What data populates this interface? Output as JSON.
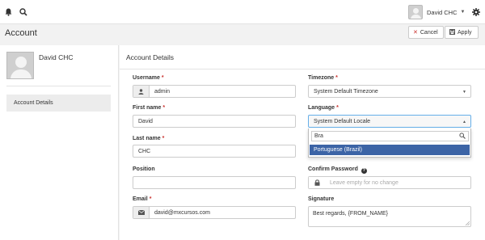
{
  "topbar": {
    "user_name": "David CHC",
    "icons": [
      "bell-icon",
      "search-icon",
      "gear-icon",
      "caret-down-icon"
    ]
  },
  "page": {
    "title": "Account",
    "cancel_label": "Cancel",
    "apply_label": "Apply"
  },
  "sidebar": {
    "user_name": "David CHC",
    "items": [
      {
        "label": "Account Details"
      }
    ]
  },
  "main": {
    "title": "Account Details",
    "username": {
      "label": "Username",
      "value": "admin",
      "icon": "user-icon"
    },
    "first_name": {
      "label": "First name",
      "value": "David"
    },
    "last_name": {
      "label": "Last name",
      "value": "CHC"
    },
    "position": {
      "label": "Position",
      "value": ""
    },
    "email": {
      "label": "Email",
      "value": "david@mxcursos.com",
      "icon": "envelope-icon"
    },
    "timezone": {
      "label": "Timezone",
      "value": "System Default Timezone"
    },
    "language": {
      "label": "Language",
      "value": "System Default Locale",
      "search_value": "Bra",
      "options": [
        "Portuguese (Brazil)"
      ]
    },
    "confirm_password": {
      "label": "Confirm Password",
      "placeholder": "Leave empty for no change",
      "icon": "lock-icon",
      "help_icon": "question-circle-icon"
    },
    "signature": {
      "label": "Signature",
      "value": "Best regards, {FROM_NAME}"
    },
    "required_marker": "*"
  },
  "colors": {
    "accent": "#3c64a6",
    "required": "#c9302c",
    "background": "#f2f2f2"
  }
}
